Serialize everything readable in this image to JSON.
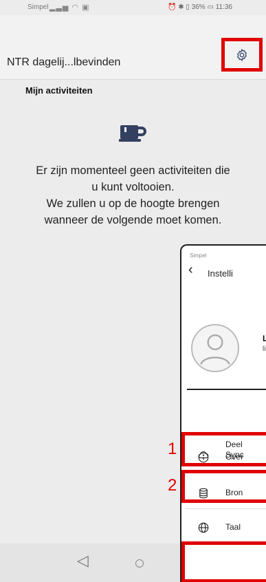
{
  "statusbar": {
    "carrier": "Simpel",
    "right": "⏰ ✱ ▯ 36% ▭ 11:36"
  },
  "appbar": {
    "title": "NTR dagelij...lbevinden",
    "settings_icon": "gear-icon"
  },
  "main": {
    "section_title": "Mijn activiteiten",
    "empty_icon": "coffee-cup-icon",
    "empty_lines": [
      "Er zijn momenteel geen activiteiten die",
      "u kunt voltooien.",
      "We zullen u op de hoogte brengen",
      "wanneer de volgende moet komen."
    ]
  },
  "navbar": {
    "back_icon": "nav-back-icon",
    "home_icon": "nav-home-icon"
  },
  "overlay": {
    "status": "Simpel",
    "title": "Instelli",
    "profile": {
      "name": "L",
      "email": "li"
    },
    "rows": {
      "share": {
        "label_line1": "Deel",
        "label_line2": "Sync",
        "icon": "cloud-icon"
      },
      "over": {
        "label": "Over",
        "icon": "info-icon"
      },
      "bron": {
        "label": "Bron",
        "icon": "database-icon"
      },
      "taal": {
        "label": "Taal",
        "icon": "globe-icon"
      }
    }
  },
  "highlights": {
    "num1": "1",
    "num2": "2"
  },
  "colors": {
    "highlight": "#e00000",
    "accent": "#3b4a6b"
  }
}
